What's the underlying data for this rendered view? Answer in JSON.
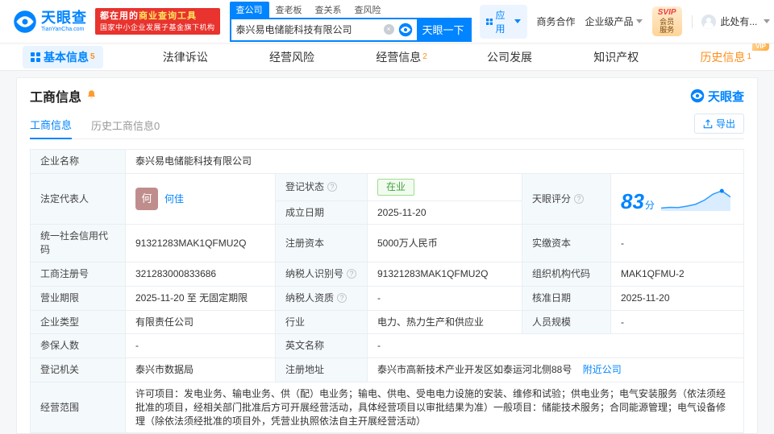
{
  "colors": {
    "brand": "#0084ff",
    "promo_red": "#e8332e",
    "status_green": "#3fa33f",
    "vip_orange": "#ff8d1a"
  },
  "header": {
    "logo_cn": "天眼查",
    "logo_en": "TianYanCha.com",
    "promo_line1_a": "都在用的",
    "promo_line1_b": "商业查询工具",
    "promo_line2": "国家中小企业发展子基金旗下机构",
    "search_tabs": [
      {
        "label": "查公司",
        "active": true
      },
      {
        "label": "查老板",
        "active": false
      },
      {
        "label": "查关系",
        "active": false
      },
      {
        "label": "查风险",
        "active": false
      }
    ],
    "search_value": "泰兴易电储能科技有限公司",
    "search_button": "天眼一下",
    "app_menu": "应用",
    "biz_coop": "商务合作",
    "enterprise_product": "企业级产品",
    "svip_line1": "SVIP",
    "svip_line2": "会员服务",
    "user_menu": "此处有..."
  },
  "nav": {
    "vip_tag": "VIP",
    "tabs": [
      {
        "label": "基本信息",
        "count": "5"
      },
      {
        "label": "法律诉讼",
        "count": ""
      },
      {
        "label": "经营风险",
        "count": ""
      },
      {
        "label": "经营信息",
        "count": "2"
      },
      {
        "label": "公司发展",
        "count": ""
      },
      {
        "label": "知识产权",
        "count": ""
      },
      {
        "label": "历史信息",
        "count": "1"
      }
    ]
  },
  "card": {
    "title": "工商信息",
    "brand": "天眼查",
    "subtab_active": "工商信息",
    "subtab_history": "历史工商信息0",
    "export_label": "导出"
  },
  "info": {
    "company_name_label": "企业名称",
    "company_name": "泰兴易电储能科技有限公司",
    "legal_rep_label": "法定代表人",
    "legal_rep_avatar": "何",
    "legal_rep_name": "何佳",
    "reg_status_label": "登记状态",
    "reg_status": "在业",
    "establish_label": "成立日期",
    "establish_date": "2025-11-20",
    "score_label": "天眼评分",
    "score_value": "83",
    "score_unit": "分",
    "uscc_label": "统一社会信用代码",
    "uscc": "91321283MAK1QFMU2Q",
    "reg_capital_label": "注册资本",
    "reg_capital": "5000万人民币",
    "paid_capital_label": "实缴资本",
    "paid_capital": "-",
    "reg_no_label": "工商注册号",
    "reg_no": "321283000833686",
    "taxpayer_id_label": "纳税人识别号",
    "taxpayer_id": "91321283MAK1QFMU2Q",
    "org_code_label": "组织机构代码",
    "org_code": "MAK1QFMU-2",
    "term_label": "营业期限",
    "term": "2025-11-20 至 无固定期限",
    "taxpayer_quali_label": "纳税人资质",
    "taxpayer_quali": "-",
    "approve_date_label": "核准日期",
    "approve_date": "2025-11-20",
    "company_type_label": "企业类型",
    "company_type": "有限责任公司",
    "industry_label": "行业",
    "industry": "电力、热力生产和供应业",
    "staff_label": "人员规模",
    "staff": "-",
    "insured_label": "参保人数",
    "insured": "-",
    "en_name_label": "英文名称",
    "en_name": "-",
    "reg_authority_label": "登记机关",
    "reg_authority": "泰兴市数据局",
    "address_label": "注册地址",
    "address": "泰兴市高新技术产业开发区如泰运河北侧88号",
    "nearby_link": "附近公司",
    "scope_label": "经营范围",
    "scope": "许可项目：发电业务、输电业务、供（配）电业务；输电、供电、受电电力设施的安装、维修和试验；供电业务；电气安装服务（依法须经批准的项目，经相关部门批准后方可开展经营活动，具体经营项目以审批结果为准）一般项目：储能技术服务；合同能源管理；电气设备修理（除依法须经批准的项目外，凭营业执照依法自主开展经营活动）"
  },
  "score_trend": [
    12,
    15,
    14,
    20,
    28,
    45,
    70,
    83,
    58
  ]
}
